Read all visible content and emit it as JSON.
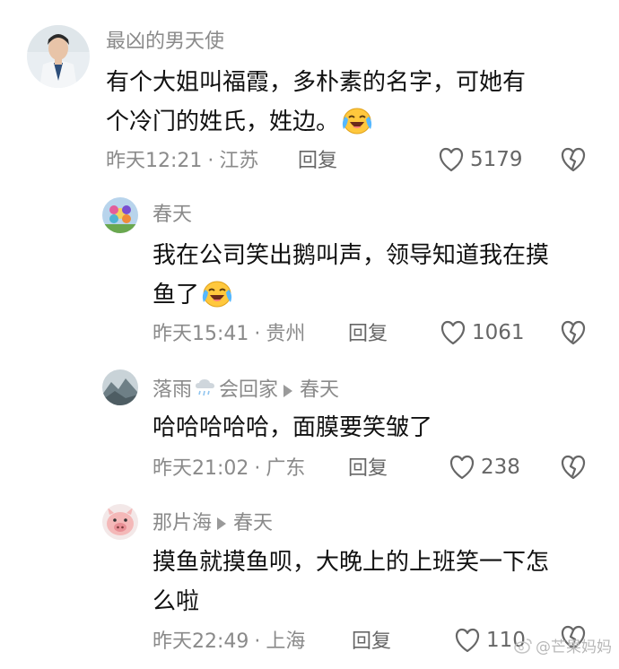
{
  "comments": [
    {
      "username": "最凶的男天使",
      "text_line1": "有个大姐叫福霞，多朴素的名字，可她有",
      "text_line2": "个冷门的姓氏，姓边。",
      "emoji": "laughing-crying-emoji",
      "time": "昨天12:21",
      "location": "江苏",
      "reply_label": "回复",
      "likes": "5179"
    },
    {
      "username": "春天",
      "text_line1": "我在公司笑出鹅叫声，领导知道我在摸",
      "text_line2": "鱼了",
      "emoji": "laughing-crying-emoji",
      "time": "昨天15:41",
      "location": "贵州",
      "reply_label": "回复",
      "likes": "1061"
    },
    {
      "username_part1": "落雨",
      "username_part2": "会回家",
      "reply_to": "春天",
      "username_emoji": "cloud-rain-emoji",
      "text_line1": "哈哈哈哈哈，面膜要笑皱了",
      "time": "昨天21:02",
      "location": "广东",
      "reply_label": "回复",
      "likes": "238"
    },
    {
      "username": "那片海",
      "reply_to": "春天",
      "text_line1": "摸鱼就摸鱼呗，大晚上的上班笑一下怎",
      "text_line2": "么啦",
      "time": "昨天22:49",
      "location": "上海",
      "reply_label": "回复",
      "likes": "110"
    }
  ],
  "separator": "·",
  "watermark": "@芒果妈妈",
  "colors": {
    "text": "#111111",
    "meta": "#8a8a8a",
    "icon": "#666666"
  }
}
